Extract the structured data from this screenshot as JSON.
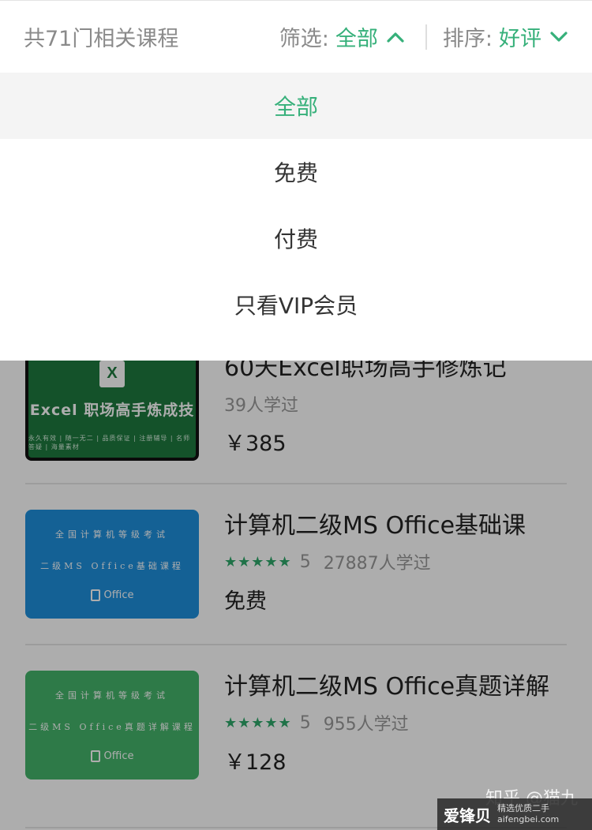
{
  "header": {
    "count_text": "共71门相关课程",
    "filter_label": "筛选:",
    "filter_value": "全部",
    "sort_label": "排序:",
    "sort_value": "好评"
  },
  "dropdown": {
    "options": [
      {
        "label": "全部",
        "selected": true
      },
      {
        "label": "免费",
        "selected": false
      },
      {
        "label": "付费",
        "selected": false
      },
      {
        "label": "只看VIP会员",
        "selected": false
      }
    ]
  },
  "courses": [
    {
      "title": "60天Excel职场高手修炼记",
      "learners": "39人学过",
      "price": "￥385",
      "thumb_title": "Excel 职场高手炼成技",
      "thumb_sub": "永久有效 | 随一无二 | 品质保证 | 注册辅导 | 名师答疑 | 海量素材",
      "thumb_logo": "X"
    },
    {
      "title": "计算机二级MS Office基础课",
      "stars": "★★★★★",
      "rating": "5",
      "learners": "27887人学过",
      "price": "免费",
      "thumb_line1": "全国计算机等级考试",
      "thumb_line2": "二级MS Office基础课程",
      "thumb_brand": "Office"
    },
    {
      "title": "计算机二级MS Office真题详解",
      "stars": "★★★★★",
      "rating": "5",
      "learners": "955人学过",
      "price": "￥128",
      "thumb_line1": "全国计算机等级考试",
      "thumb_line2": "二级MS Office真题详解课程",
      "thumb_brand": "Office"
    }
  ],
  "watermark": {
    "zhihu": "知乎 @猫九",
    "brand": "爱锋贝",
    "tag1": "精选优质二手",
    "tag2": "aifengbei.com"
  },
  "colors": {
    "accent_green": "#36b07a",
    "overlay": "rgba(0,0,0,0.32)"
  }
}
